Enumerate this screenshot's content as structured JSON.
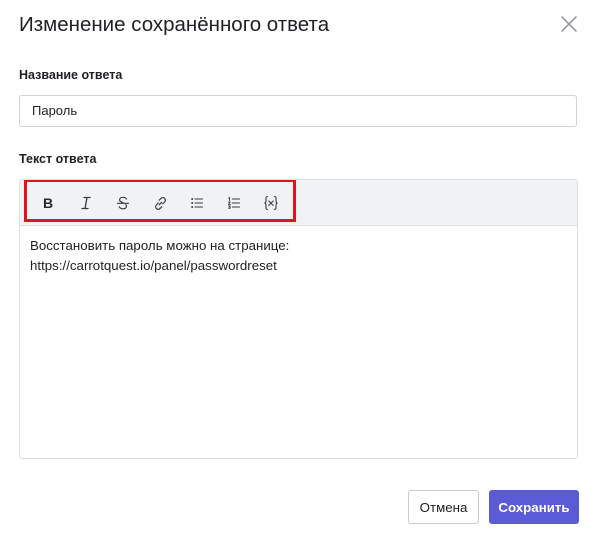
{
  "dialog": {
    "title": "Изменение сохранённого ответа"
  },
  "name_field": {
    "label": "Название ответа",
    "value": "Пароль"
  },
  "text_field": {
    "label": "Текст ответа",
    "lines": [
      "Восстановить пароль можно на странице:",
      "https://carrotquest.io/panel/passwordreset"
    ]
  },
  "toolbar": {
    "bold_label": "B",
    "buttons": [
      "bold-icon",
      "italic-icon",
      "strikethrough-icon",
      "link-icon",
      "bullet-list-icon",
      "numbered-list-icon",
      "variable-icon"
    ],
    "highlight_color": "#e3141b"
  },
  "footer": {
    "cancel_label": "Отмена",
    "save_label": "Сохранить"
  },
  "colors": {
    "primary": "#5b5bd6",
    "toolbar_bg": "#f1f2f4"
  }
}
